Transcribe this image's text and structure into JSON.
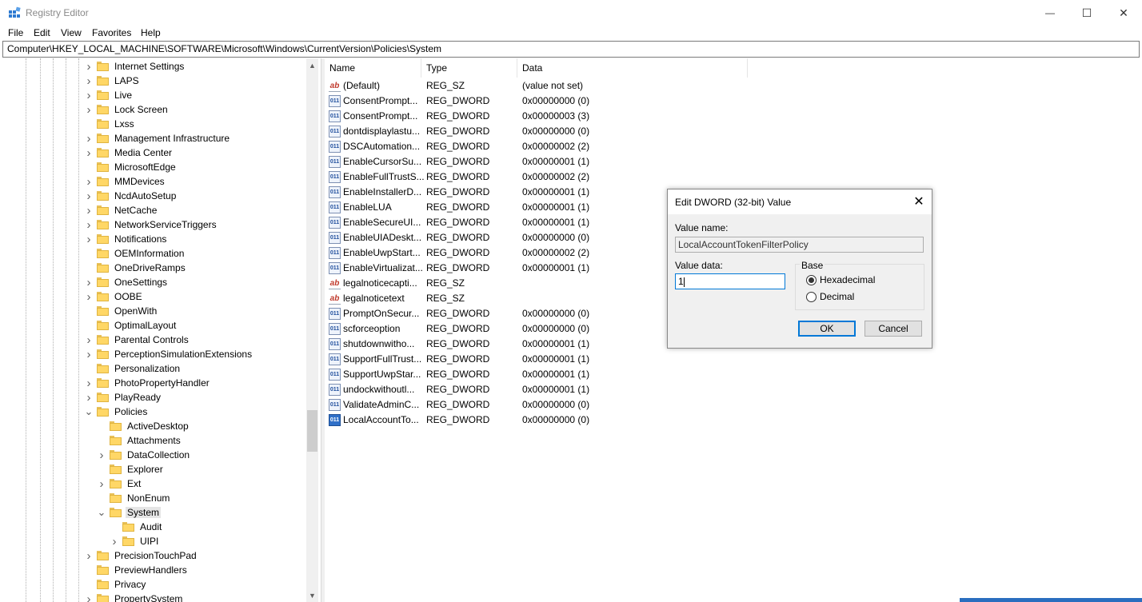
{
  "window": {
    "title": "Registry Editor",
    "minimize": "—",
    "maximize": "☐",
    "close": "✕"
  },
  "menu": [
    "File",
    "Edit",
    "View",
    "Favorites",
    "Help"
  ],
  "address": "Computer\\HKEY_LOCAL_MACHINE\\SOFTWARE\\Microsoft\\Windows\\CurrentVersion\\Policies\\System",
  "tree": [
    {
      "label": "Internet Settings",
      "level": 0,
      "expander": "collapsed"
    },
    {
      "label": "LAPS",
      "level": 0,
      "expander": "collapsed"
    },
    {
      "label": "Live",
      "level": 0,
      "expander": "collapsed"
    },
    {
      "label": "Lock Screen",
      "level": 0,
      "expander": "collapsed"
    },
    {
      "label": "Lxss",
      "level": 0,
      "expander": "none"
    },
    {
      "label": "Management Infrastructure",
      "level": 0,
      "expander": "collapsed"
    },
    {
      "label": "Media Center",
      "level": 0,
      "expander": "collapsed"
    },
    {
      "label": "MicrosoftEdge",
      "level": 0,
      "expander": "none"
    },
    {
      "label": "MMDevices",
      "level": 0,
      "expander": "collapsed"
    },
    {
      "label": "NcdAutoSetup",
      "level": 0,
      "expander": "collapsed"
    },
    {
      "label": "NetCache",
      "level": 0,
      "expander": "collapsed"
    },
    {
      "label": "NetworkServiceTriggers",
      "level": 0,
      "expander": "collapsed"
    },
    {
      "label": "Notifications",
      "level": 0,
      "expander": "collapsed"
    },
    {
      "label": "OEMInformation",
      "level": 0,
      "expander": "none"
    },
    {
      "label": "OneDriveRamps",
      "level": 0,
      "expander": "none"
    },
    {
      "label": "OneSettings",
      "level": 0,
      "expander": "collapsed"
    },
    {
      "label": "OOBE",
      "level": 0,
      "expander": "collapsed"
    },
    {
      "label": "OpenWith",
      "level": 0,
      "expander": "none"
    },
    {
      "label": "OptimalLayout",
      "level": 0,
      "expander": "none"
    },
    {
      "label": "Parental Controls",
      "level": 0,
      "expander": "collapsed"
    },
    {
      "label": "PerceptionSimulationExtensions",
      "level": 0,
      "expander": "collapsed"
    },
    {
      "label": "Personalization",
      "level": 0,
      "expander": "none"
    },
    {
      "label": "PhotoPropertyHandler",
      "level": 0,
      "expander": "collapsed"
    },
    {
      "label": "PlayReady",
      "level": 0,
      "expander": "collapsed"
    },
    {
      "label": "Policies",
      "level": 0,
      "expander": "expanded"
    },
    {
      "label": "ActiveDesktop",
      "level": 1,
      "expander": "none"
    },
    {
      "label": "Attachments",
      "level": 1,
      "expander": "none"
    },
    {
      "label": "DataCollection",
      "level": 1,
      "expander": "collapsed"
    },
    {
      "label": "Explorer",
      "level": 1,
      "expander": "none"
    },
    {
      "label": "Ext",
      "level": 1,
      "expander": "collapsed"
    },
    {
      "label": "NonEnum",
      "level": 1,
      "expander": "none"
    },
    {
      "label": "System",
      "level": 1,
      "expander": "expanded",
      "selected": true
    },
    {
      "label": "Audit",
      "level": 2,
      "expander": "none"
    },
    {
      "label": "UIPI",
      "level": 2,
      "expander": "collapsed"
    },
    {
      "label": "PrecisionTouchPad",
      "level": 0,
      "expander": "collapsed"
    },
    {
      "label": "PreviewHandlers",
      "level": 0,
      "expander": "none"
    },
    {
      "label": "Privacy",
      "level": 0,
      "expander": "none"
    },
    {
      "label": "PropertySystem",
      "level": 0,
      "expander": "collapsed"
    }
  ],
  "columns": {
    "name": "Name",
    "type": "Type",
    "data": "Data"
  },
  "values": [
    {
      "icon": "string-value-icon",
      "glyph": "ab",
      "name": "(Default)",
      "type": "REG_SZ",
      "data": "(value not set)"
    },
    {
      "icon": "dword-value-icon",
      "glyph": "011",
      "name": "ConsentPrompt...",
      "type": "REG_DWORD",
      "data": "0x00000000 (0)"
    },
    {
      "icon": "dword-value-icon",
      "glyph": "011",
      "name": "ConsentPrompt...",
      "type": "REG_DWORD",
      "data": "0x00000003 (3)"
    },
    {
      "icon": "dword-value-icon",
      "glyph": "011",
      "name": "dontdisplaylastu...",
      "type": "REG_DWORD",
      "data": "0x00000000 (0)"
    },
    {
      "icon": "dword-value-icon",
      "glyph": "011",
      "name": "DSCAutomation...",
      "type": "REG_DWORD",
      "data": "0x00000002 (2)"
    },
    {
      "icon": "dword-value-icon",
      "glyph": "011",
      "name": "EnableCursorSu...",
      "type": "REG_DWORD",
      "data": "0x00000001 (1)"
    },
    {
      "icon": "dword-value-icon",
      "glyph": "011",
      "name": "EnableFullTrustS...",
      "type": "REG_DWORD",
      "data": "0x00000002 (2)"
    },
    {
      "icon": "dword-value-icon",
      "glyph": "011",
      "name": "EnableInstallerD...",
      "type": "REG_DWORD",
      "data": "0x00000001 (1)"
    },
    {
      "icon": "dword-value-icon",
      "glyph": "011",
      "name": "EnableLUA",
      "type": "REG_DWORD",
      "data": "0x00000001 (1)"
    },
    {
      "icon": "dword-value-icon",
      "glyph": "011",
      "name": "EnableSecureUI...",
      "type": "REG_DWORD",
      "data": "0x00000001 (1)"
    },
    {
      "icon": "dword-value-icon",
      "glyph": "011",
      "name": "EnableUIADeskt...",
      "type": "REG_DWORD",
      "data": "0x00000000 (0)"
    },
    {
      "icon": "dword-value-icon",
      "glyph": "011",
      "name": "EnableUwpStart...",
      "type": "REG_DWORD",
      "data": "0x00000002 (2)"
    },
    {
      "icon": "dword-value-icon",
      "glyph": "011",
      "name": "EnableVirtualizat...",
      "type": "REG_DWORD",
      "data": "0x00000001 (1)"
    },
    {
      "icon": "string-value-icon",
      "glyph": "ab",
      "name": "legalnoticecapti...",
      "type": "REG_SZ",
      "data": ""
    },
    {
      "icon": "string-value-icon",
      "glyph": "ab",
      "name": "legalnoticetext",
      "type": "REG_SZ",
      "data": ""
    },
    {
      "icon": "dword-value-icon",
      "glyph": "011",
      "name": "PromptOnSecur...",
      "type": "REG_DWORD",
      "data": "0x00000000 (0)"
    },
    {
      "icon": "dword-value-icon",
      "glyph": "011",
      "name": "scforceoption",
      "type": "REG_DWORD",
      "data": "0x00000000 (0)"
    },
    {
      "icon": "dword-value-icon",
      "glyph": "011",
      "name": "shutdownwitho...",
      "type": "REG_DWORD",
      "data": "0x00000001 (1)"
    },
    {
      "icon": "dword-value-icon",
      "glyph": "011",
      "name": "SupportFullTrust...",
      "type": "REG_DWORD",
      "data": "0x00000001 (1)"
    },
    {
      "icon": "dword-value-icon",
      "glyph": "011",
      "name": "SupportUwpStar...",
      "type": "REG_DWORD",
      "data": "0x00000001 (1)"
    },
    {
      "icon": "dword-value-icon",
      "glyph": "011",
      "name": "undockwithoutl...",
      "type": "REG_DWORD",
      "data": "0x00000001 (1)"
    },
    {
      "icon": "dword-value-icon",
      "glyph": "011",
      "name": "ValidateAdminC...",
      "type": "REG_DWORD",
      "data": "0x00000000 (0)"
    },
    {
      "icon": "dword-value-icon",
      "glyph": "011",
      "name": "LocalAccountTo...",
      "type": "REG_DWORD",
      "data": "0x00000000 (0)",
      "selected": true
    }
  ],
  "dialog": {
    "title": "Edit DWORD (32-bit) Value",
    "close": "✕",
    "value_name_label": "Value name:",
    "value_name": "LocalAccountTokenFilterPolicy",
    "value_data_label": "Value data:",
    "value_data": "1",
    "base_label": "Base",
    "hex_label": "Hexadecimal",
    "dec_label": "Decimal",
    "base_selected": "Hexadecimal",
    "ok": "OK",
    "cancel": "Cancel"
  },
  "colors": {
    "accent": "#0078d7",
    "folder": "#ffd766",
    "selection": "#e5e5e5"
  }
}
